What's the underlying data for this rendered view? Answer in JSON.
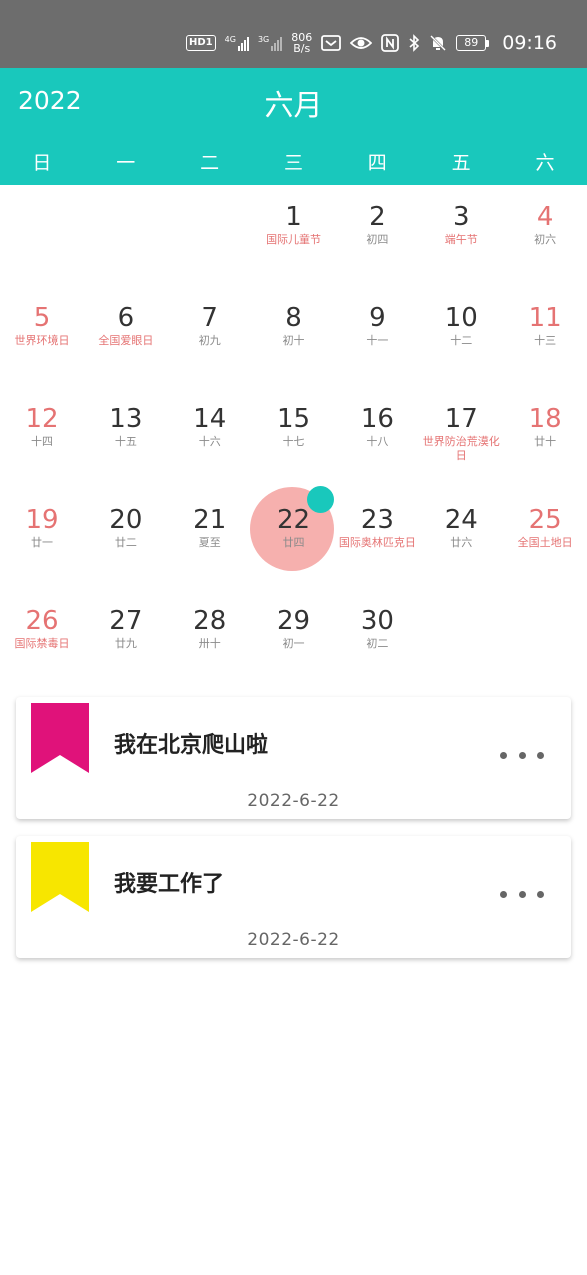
{
  "status_bar": {
    "hd_badge": "HD",
    "sim_badge": "1",
    "signal1_label": "4G",
    "signal2_label": "3G",
    "net_speed_value": "806",
    "net_speed_unit": "B/s",
    "battery": "89",
    "time": "09:16",
    "icons": [
      "hd-icon",
      "signal-icon",
      "signal-icon",
      "mail-icon",
      "eye-icon",
      "nfc-icon",
      "bluetooth-icon",
      "bell-off-icon",
      "battery-icon"
    ]
  },
  "header": {
    "year": "2022",
    "month": "六月",
    "weekdays": [
      "日",
      "一",
      "二",
      "三",
      "四",
      "五",
      "六"
    ]
  },
  "calendar": {
    "selected_day": 22,
    "accent_color": "#19c8bc",
    "weekend_color": "#e57373",
    "weeks": [
      [
        null,
        null,
        null,
        {
          "day": "1",
          "sub": "国际儿童节",
          "festival": true
        },
        {
          "day": "2",
          "sub": "初四"
        },
        {
          "day": "3",
          "sub": "端午节",
          "festival": true
        },
        {
          "day": "4",
          "sub": "初六",
          "weekend": true
        }
      ],
      [
        {
          "day": "5",
          "sub": "世界环境日",
          "weekend": true,
          "festival": true
        },
        {
          "day": "6",
          "sub": "全国爱眼日",
          "festival": true
        },
        {
          "day": "7",
          "sub": "初九"
        },
        {
          "day": "8",
          "sub": "初十"
        },
        {
          "day": "9",
          "sub": "十一"
        },
        {
          "day": "10",
          "sub": "十二"
        },
        {
          "day": "11",
          "sub": "十三",
          "weekend": true
        }
      ],
      [
        {
          "day": "12",
          "sub": "十四",
          "weekend": true
        },
        {
          "day": "13",
          "sub": "十五"
        },
        {
          "day": "14",
          "sub": "十六"
        },
        {
          "day": "15",
          "sub": "十七"
        },
        {
          "day": "16",
          "sub": "十八"
        },
        {
          "day": "17",
          "sub": "世界防治荒漠化日",
          "festival": true
        },
        {
          "day": "18",
          "sub": "廿十",
          "weekend": true
        }
      ],
      [
        {
          "day": "19",
          "sub": "廿一",
          "weekend": true
        },
        {
          "day": "20",
          "sub": "廿二"
        },
        {
          "day": "21",
          "sub": "夏至"
        },
        {
          "day": "22",
          "sub": "廿四"
        },
        {
          "day": "23",
          "sub": "国际奥林匹克日",
          "festival": true
        },
        {
          "day": "24",
          "sub": "廿六"
        },
        {
          "day": "25",
          "sub": "全国土地日",
          "weekend": true,
          "festival": true
        }
      ],
      [
        {
          "day": "26",
          "sub": "国际禁毒日",
          "weekend": true,
          "festival": true
        },
        {
          "day": "27",
          "sub": "廿九"
        },
        {
          "day": "28",
          "sub": "卅十"
        },
        {
          "day": "29",
          "sub": "初一"
        },
        {
          "day": "30",
          "sub": "初二"
        },
        null,
        null
      ]
    ]
  },
  "cards": [
    {
      "title": "我在北京爬山啦",
      "date": "2022-6-22",
      "bookmark_color": "#e0127a",
      "icon": "bookmark-icon",
      "menu_icon": "more-icon"
    },
    {
      "title": "我要工作了",
      "date": "2022-6-22",
      "bookmark_color": "#f7e600",
      "icon": "bookmark-icon",
      "menu_icon": "more-icon"
    }
  ]
}
